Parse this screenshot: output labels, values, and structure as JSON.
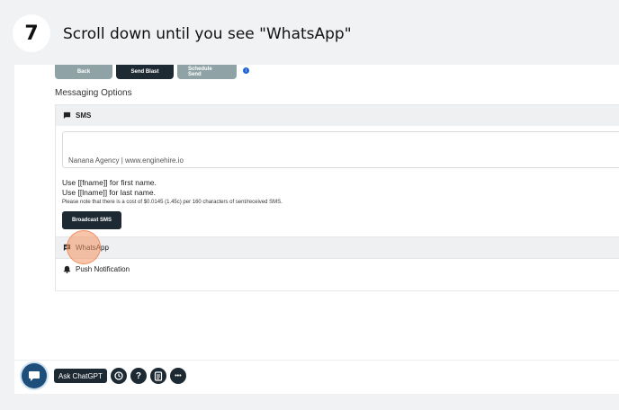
{
  "step": {
    "number": "7",
    "title": "Scroll down until you see \"WhatsApp\""
  },
  "toolbar": {
    "back_label": "Back",
    "send_label": "Send Blast",
    "schedule_label": "Schedule Send"
  },
  "messaging": {
    "section_title": "Messaging Options",
    "sms": {
      "label": "SMS",
      "message_value": "Nanana Agency | www.enginehire.io",
      "hint_first": "Use [[fname]] for first name.",
      "hint_last": "Use [[lname]] for last name.",
      "cost_note": "Please note that there is a cost of $0.0145 (1.45c) per 160 characters of sent/received SMS.",
      "broadcast_label": "Broadcast SMS"
    },
    "whatsapp": {
      "label": "WhatsApp"
    },
    "push": {
      "label": "Push Notification"
    }
  },
  "assistant": {
    "ask_label": "Ask ChatGPT",
    "help_glyph": "?",
    "more_glyph": "•••"
  },
  "icons": {
    "info": "info-icon",
    "sms": "chat-icon",
    "whatsapp": "chat-icon",
    "push": "bell-icon",
    "history": "history-icon",
    "help": "help-icon",
    "doc": "document-icon",
    "more": "more-icon"
  },
  "colors": {
    "dark": "#1e2a33",
    "muted_button": "#8fa3a6",
    "info": "#1e63d8",
    "highlight": "#f49664"
  }
}
